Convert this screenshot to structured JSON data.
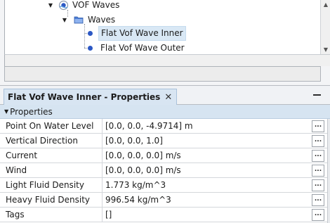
{
  "tree": {
    "items": [
      {
        "label": "VOF Waves",
        "icon": "vof-waves-icon",
        "expanded": true
      },
      {
        "label": "Waves",
        "icon": "folder-icon",
        "expanded": true
      },
      {
        "label": "Flat Vof Wave Inner",
        "icon": "dot-icon",
        "selected": true
      },
      {
        "label": "Flat Vof Wave Outer",
        "icon": "dot-icon",
        "selected": false
      }
    ]
  },
  "properties_panel": {
    "tab_title": "Flat Vof Wave Inner - Properties",
    "group_label": "Properties",
    "rows": [
      {
        "name": "Point On Water Level",
        "value": "[0.0, 0.0, -4.9714] m"
      },
      {
        "name": "Vertical Direction",
        "value": "[0.0, 0.0, 1.0]"
      },
      {
        "name": "Current",
        "value": "[0.0, 0.0, 0.0] m/s"
      },
      {
        "name": "Wind",
        "value": "[0.0, 0.0, 0.0] m/s"
      },
      {
        "name": "Light Fluid Density",
        "value": "1.773 kg/m^3"
      },
      {
        "name": "Heavy Fluid Density",
        "value": "996.54 kg/m^3"
      },
      {
        "name": "Tags",
        "value": "[]"
      }
    ],
    "ellipsis_label": "..."
  },
  "colors": {
    "selection": "#d9e8f5",
    "group_header": "#d6e4f1",
    "tab_active": "#d8e5f2",
    "dot_icon": "#2c58c4"
  }
}
